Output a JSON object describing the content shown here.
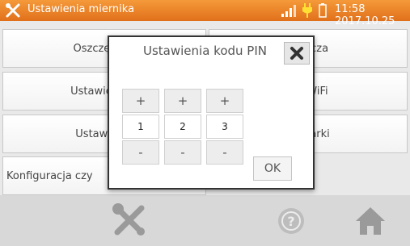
{
  "statusbar": {
    "title": "Ustawienia miernika",
    "time": "11:58 2017.10.25",
    "icons": [
      "tools-icon",
      "signal-icon",
      "plug-icon",
      "battery-icon"
    ]
  },
  "menu": {
    "left": [
      "Oszczędnoś",
      "Ustawienia d",
      "Ustawienia",
      "Konfiguracja czy"
    ],
    "right": [
      "ietlacza",
      "cja WiFi",
      "drukarki",
      ""
    ]
  },
  "dialog": {
    "title": "Ustawienia kodu PIN",
    "plus_label": "+",
    "minus_label": "-",
    "digits": [
      "1",
      "2",
      "3"
    ],
    "ok_label": "OK"
  },
  "bottom": {
    "icons": [
      "tools-icon",
      "help-icon",
      "home-icon"
    ]
  },
  "colors": {
    "accent": "#e8832a",
    "bottom_bar": "#d8d8d8"
  }
}
